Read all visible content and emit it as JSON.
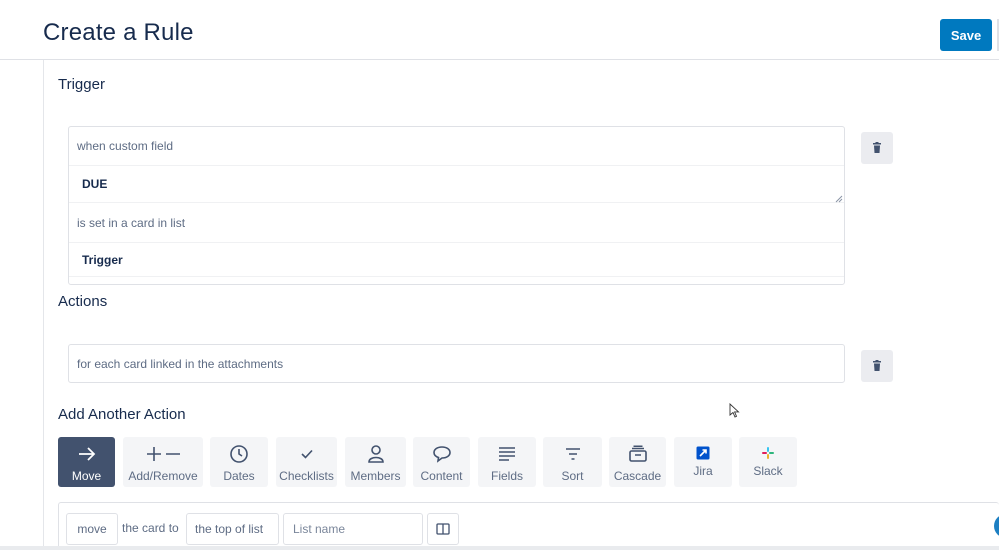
{
  "header": {
    "title": "Create a Rule",
    "save_label": "Save"
  },
  "trigger": {
    "section_title": "Trigger",
    "rows": [
      "when custom field",
      "DUE",
      "is set in a card in list",
      "Trigger"
    ],
    "delete_icon": "trash-icon"
  },
  "actions": {
    "section_title": "Actions",
    "text": "for each card linked in the attachments",
    "delete_icon": "trash-icon"
  },
  "add_action": {
    "section_title": "Add Another Action",
    "categories": [
      {
        "label": "Move",
        "icon": "arrow-right-icon",
        "active": true
      },
      {
        "label": "Add/Remove",
        "icon": "plus-minus-icon",
        "active": false
      },
      {
        "label": "Dates",
        "icon": "clock-icon",
        "active": false
      },
      {
        "label": "Checklists",
        "icon": "check-icon",
        "active": false
      },
      {
        "label": "Members",
        "icon": "person-icon",
        "active": false
      },
      {
        "label": "Content",
        "icon": "speech-bubble-icon",
        "active": false
      },
      {
        "label": "Fields",
        "icon": "lines-icon",
        "active": false
      },
      {
        "label": "Sort",
        "icon": "filter-icon",
        "active": false
      },
      {
        "label": "Cascade",
        "icon": "archive-icon",
        "active": false
      },
      {
        "label": "Jira",
        "icon": "jira-icon",
        "active": false
      },
      {
        "label": "Slack",
        "icon": "slack-icon",
        "active": false
      }
    ]
  },
  "builder": {
    "move_chip": "move",
    "text_between": "the card to",
    "position_chip": "the top of list",
    "list_placeholder": "List name",
    "board_icon": "board-icon"
  },
  "colors": {
    "accent": "#0079bf",
    "active_category": "#42526e",
    "text": "#172b4d",
    "muted": "#5e6c84"
  }
}
